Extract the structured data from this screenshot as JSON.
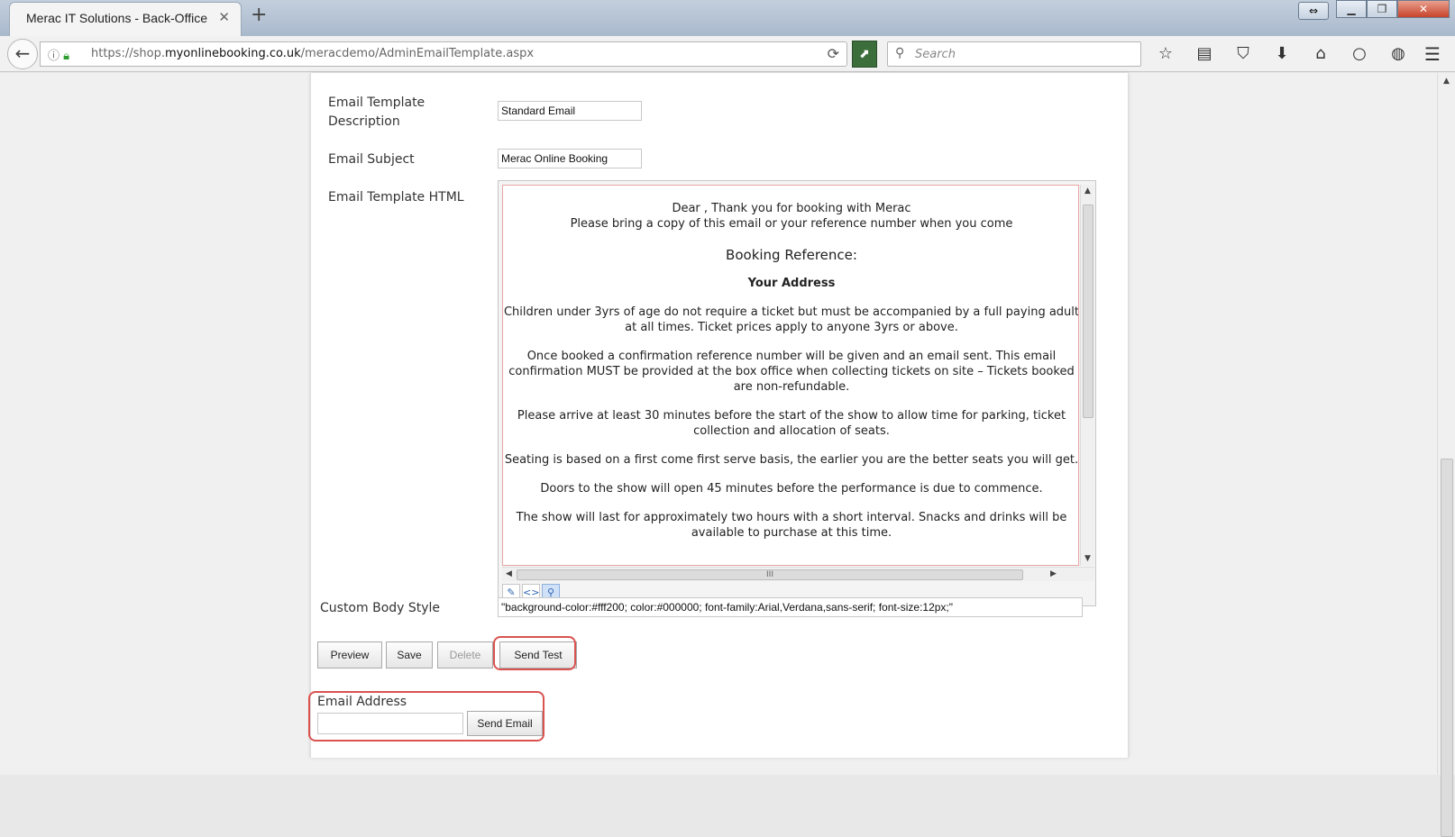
{
  "browser": {
    "tab_title": "Merac IT Solutions - Back-Office",
    "tab_close": "✕",
    "new_tab": "+",
    "url_prefix": "https://shop.",
    "url_domain": "myonlinebooking.co.uk",
    "url_path": "/meracdemo/AdminEmailTemplate.aspx",
    "search_placeholder": "Search"
  },
  "form": {
    "description_label": "Email Template Description",
    "description_value": "Standard Email",
    "subject_label": "Email Subject",
    "subject_value": "Merac Online Booking",
    "html_label": "Email Template HTML",
    "custom_style_label": "Custom Body Style",
    "custom_style_value": "\"background-color:#fff200; color:#000000; font-family:Arial,Verdana,sans-serif; font-size:12px;\""
  },
  "editor": {
    "line1": "Dear , Thank you for booking with Merac",
    "line2": "Please bring a copy of this email or your reference number when you come",
    "booking_reference": "Booking Reference:",
    "your_address": "Your Address",
    "para1": "Children under 3yrs of age do not require a ticket but must be accompanied by a full paying adult at all times. Ticket prices apply to anyone 3yrs or above.",
    "para2": "Once booked a confirmation reference number will be given and an email sent. This email confirmation MUST be provided at the box office when collecting tickets on site – Tickets booked are non-refundable.",
    "para3": "Please arrive at least 30 minutes before the start of the show to allow time for parking, ticket collection and allocation of seats.",
    "para4": "Seating is based on a first come first serve basis, the earlier you are the better seats you will get.",
    "para5": "Doors to the show will open 45 minutes before the performance is due to commence.",
    "para6": "The show will last for approximately two hours with a short interval. Snacks and drinks will be available to purchase at this time."
  },
  "actions": {
    "preview": "Preview",
    "save": "Save",
    "delete": "Delete",
    "send_test": "Send Test"
  },
  "email_section": {
    "label": "Email Address",
    "input_value": "",
    "send_button": "Send Email"
  },
  "colors": {
    "highlight": "#d9534f"
  }
}
